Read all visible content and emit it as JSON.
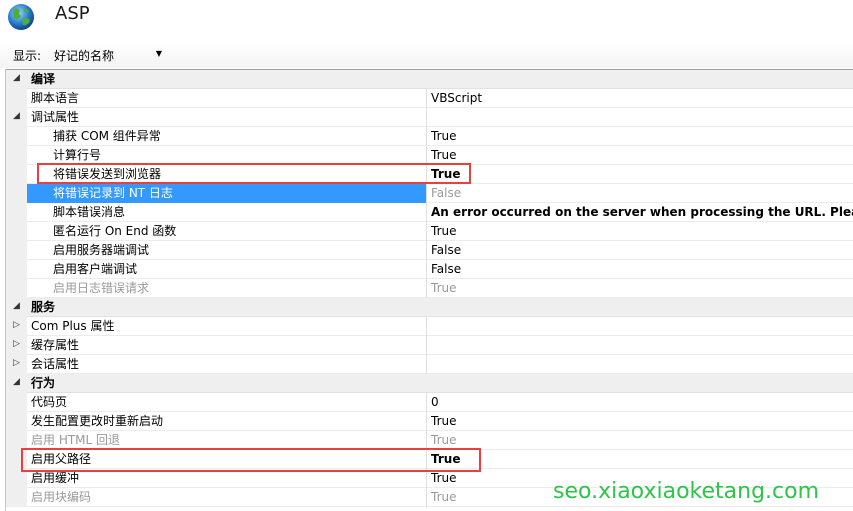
{
  "header": {
    "title": "ASP",
    "icon": "globe-icon"
  },
  "display": {
    "label": "显示:",
    "value": "好记的名称"
  },
  "categories": {
    "compile": "编译",
    "services": "服务",
    "behavior": "行为"
  },
  "rows": {
    "script_lang": {
      "name": "脚本语言",
      "value": "VBScript"
    },
    "debug": {
      "name": "调试属性",
      "value": ""
    },
    "catch_com": {
      "name": "捕获 COM 组件异常",
      "value": "True"
    },
    "calc_line": {
      "name": "计算行号",
      "value": "True"
    },
    "send_errors": {
      "name": "将错误发送到浏览器",
      "value": "True"
    },
    "log_nt": {
      "name": "将错误记录到 NT 日志",
      "value": "False"
    },
    "script_error_msg": {
      "name": "脚本错误消息",
      "value": "An error occurred on the server when processing the URL. Please con"
    },
    "anon_onend": {
      "name": "匿名运行 On End 函数",
      "value": "True"
    },
    "server_debug": {
      "name": "启用服务器端调试",
      "value": "False"
    },
    "client_debug": {
      "name": "启用客户端调试",
      "value": "False"
    },
    "log_error_req": {
      "name": "启用日志错误请求",
      "value": "True"
    },
    "com_plus": {
      "name": "Com Plus 属性",
      "value": ""
    },
    "cache": {
      "name": "缓存属性",
      "value": ""
    },
    "session": {
      "name": "会话属性",
      "value": ""
    },
    "code_page": {
      "name": "代码页",
      "value": "0"
    },
    "restart_on_change": {
      "name": "发生配置更改时重新启动",
      "value": "True"
    },
    "html_fallback": {
      "name": "启用 HTML 回退",
      "value": "True"
    },
    "parent_paths": {
      "name": "启用父路径",
      "value": "True"
    },
    "buffering": {
      "name": "启用缓冲",
      "value": "True"
    },
    "chunked": {
      "name": "启用块编码",
      "value": "True"
    }
  },
  "watermark": "seo.xiaoxiaoketang.com",
  "colors": {
    "selection": "#3399ff",
    "highlight": "#e8403a",
    "watermark": "#2ec44a"
  }
}
